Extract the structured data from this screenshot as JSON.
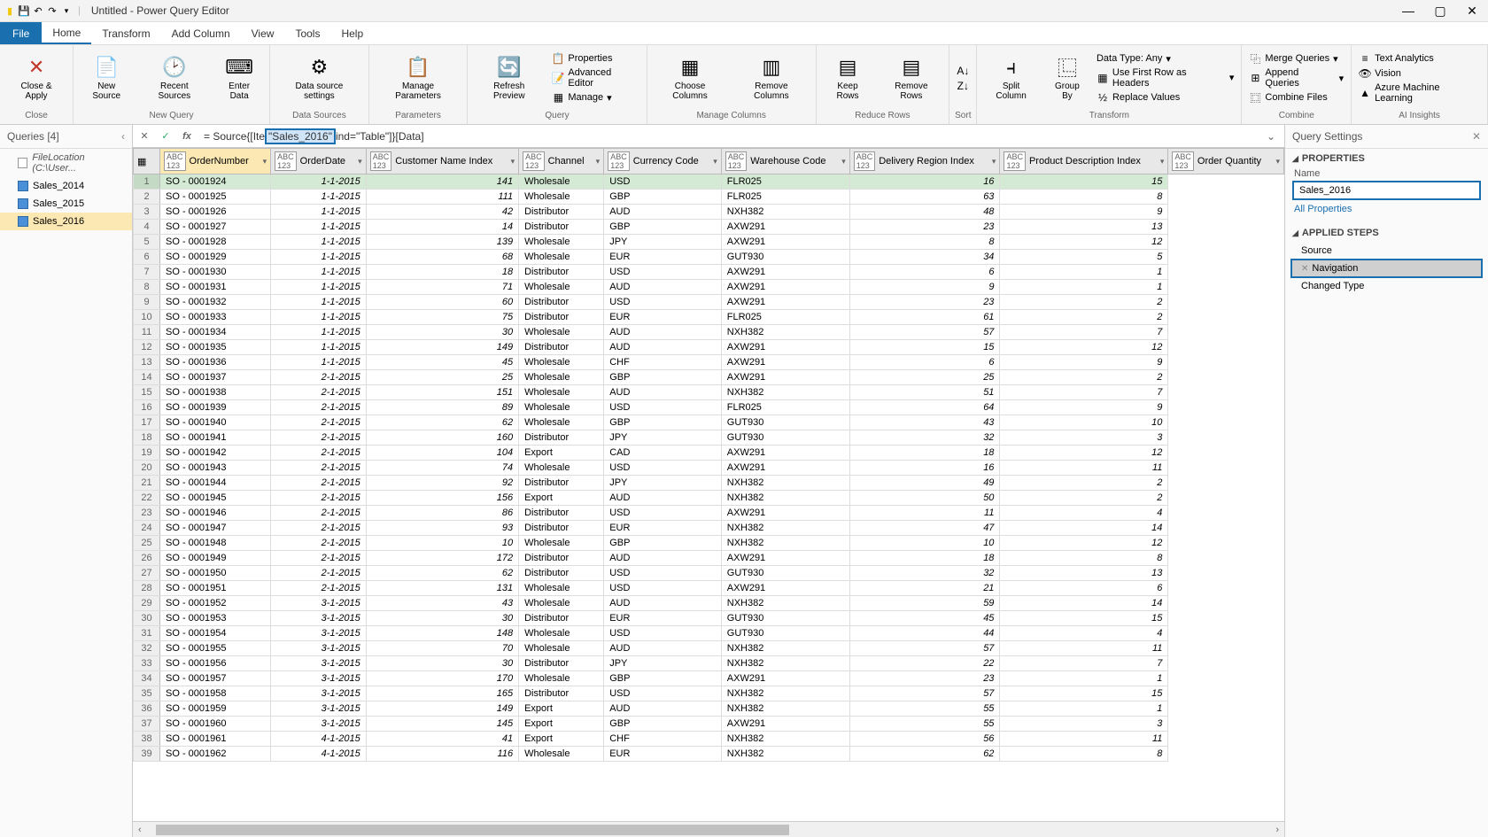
{
  "window": {
    "title": "Untitled - Power Query Editor"
  },
  "menu": {
    "file": "File",
    "tabs": [
      "Home",
      "Transform",
      "Add Column",
      "View",
      "Tools",
      "Help"
    ],
    "activeTab": 0
  },
  "ribbon": {
    "close": {
      "close_apply": "Close &\nApply",
      "group": "Close"
    },
    "newquery": {
      "new_source": "New\nSource",
      "recent_sources": "Recent\nSources",
      "enter_data": "Enter\nData",
      "group": "New Query"
    },
    "datasources": {
      "ds_settings": "Data source\nsettings",
      "group": "Data Sources"
    },
    "parameters": {
      "manage_params": "Manage\nParameters",
      "group": "Parameters"
    },
    "query": {
      "refresh": "Refresh\nPreview",
      "props": "Properties",
      "adv": "Advanced Editor",
      "manage": "Manage",
      "group": "Query"
    },
    "mcols": {
      "choose": "Choose\nColumns",
      "remove": "Remove\nColumns",
      "group": "Manage Columns"
    },
    "rrows": {
      "keep": "Keep\nRows",
      "remove": "Remove\nRows",
      "group": "Reduce Rows"
    },
    "sort": {
      "group": "Sort"
    },
    "transform": {
      "split": "Split\nColumn",
      "groupby": "Group\nBy",
      "dtype": "Data Type: Any",
      "firstrow": "Use First Row as Headers",
      "replace": "Replace Values",
      "group": "Transform"
    },
    "combine": {
      "merge": "Merge Queries",
      "append": "Append Queries",
      "files": "Combine Files",
      "group": "Combine"
    },
    "ai": {
      "text": "Text Analytics",
      "vision": "Vision",
      "ml": "Azure Machine Learning",
      "group": "AI Insights"
    }
  },
  "queries": {
    "header": "Queries [4]",
    "items": [
      {
        "label": "FileLocation (C:\\User...",
        "type": "loc"
      },
      {
        "label": "Sales_2014",
        "type": "q"
      },
      {
        "label": "Sales_2015",
        "type": "q"
      },
      {
        "label": "Sales_2016",
        "type": "q",
        "sel": true
      }
    ]
  },
  "formula": {
    "prefix": "= Source{[Ite",
    "highlight": "\"Sales_2016\"",
    "suffix": "ind=\"Table\"]}[Data]"
  },
  "columns": [
    "OrderNumber",
    "OrderDate",
    "Customer Name Index",
    "Channel",
    "Currency Code",
    "Warehouse Code",
    "Delivery Region Index",
    "Product Description Index",
    "Order Quantity"
  ],
  "rows": [
    {
      "n": 1,
      "on": "SO - 0001924",
      "od": "1-1-2015",
      "cn": 141,
      "ch": "Wholesale",
      "cc": "USD",
      "wc": "FLR025",
      "dr": 16,
      "pd": 15
    },
    {
      "n": 2,
      "on": "SO - 0001925",
      "od": "1-1-2015",
      "cn": 111,
      "ch": "Wholesale",
      "cc": "GBP",
      "wc": "FLR025",
      "dr": 63,
      "pd": 8
    },
    {
      "n": 3,
      "on": "SO - 0001926",
      "od": "1-1-2015",
      "cn": 42,
      "ch": "Distributor",
      "cc": "AUD",
      "wc": "NXH382",
      "dr": 48,
      "pd": 9
    },
    {
      "n": 4,
      "on": "SO - 0001927",
      "od": "1-1-2015",
      "cn": 14,
      "ch": "Distributor",
      "cc": "GBP",
      "wc": "AXW291",
      "dr": 23,
      "pd": 13
    },
    {
      "n": 5,
      "on": "SO - 0001928",
      "od": "1-1-2015",
      "cn": 139,
      "ch": "Wholesale",
      "cc": "JPY",
      "wc": "AXW291",
      "dr": 8,
      "pd": 12
    },
    {
      "n": 6,
      "on": "SO - 0001929",
      "od": "1-1-2015",
      "cn": 68,
      "ch": "Wholesale",
      "cc": "EUR",
      "wc": "GUT930",
      "dr": 34,
      "pd": 5
    },
    {
      "n": 7,
      "on": "SO - 0001930",
      "od": "1-1-2015",
      "cn": 18,
      "ch": "Distributor",
      "cc": "USD",
      "wc": "AXW291",
      "dr": 6,
      "pd": 1
    },
    {
      "n": 8,
      "on": "SO - 0001931",
      "od": "1-1-2015",
      "cn": 71,
      "ch": "Wholesale",
      "cc": "AUD",
      "wc": "AXW291",
      "dr": 9,
      "pd": 1
    },
    {
      "n": 9,
      "on": "SO - 0001932",
      "od": "1-1-2015",
      "cn": 60,
      "ch": "Distributor",
      "cc": "USD",
      "wc": "AXW291",
      "dr": 23,
      "pd": 2
    },
    {
      "n": 10,
      "on": "SO - 0001933",
      "od": "1-1-2015",
      "cn": 75,
      "ch": "Distributor",
      "cc": "EUR",
      "wc": "FLR025",
      "dr": 61,
      "pd": 2
    },
    {
      "n": 11,
      "on": "SO - 0001934",
      "od": "1-1-2015",
      "cn": 30,
      "ch": "Wholesale",
      "cc": "AUD",
      "wc": "NXH382",
      "dr": 57,
      "pd": 7
    },
    {
      "n": 12,
      "on": "SO - 0001935",
      "od": "1-1-2015",
      "cn": 149,
      "ch": "Distributor",
      "cc": "AUD",
      "wc": "AXW291",
      "dr": 15,
      "pd": 12
    },
    {
      "n": 13,
      "on": "SO - 0001936",
      "od": "1-1-2015",
      "cn": 45,
      "ch": "Wholesale",
      "cc": "CHF",
      "wc": "AXW291",
      "dr": 6,
      "pd": 9
    },
    {
      "n": 14,
      "on": "SO - 0001937",
      "od": "2-1-2015",
      "cn": 25,
      "ch": "Wholesale",
      "cc": "GBP",
      "wc": "AXW291",
      "dr": 25,
      "pd": 2
    },
    {
      "n": 15,
      "on": "SO - 0001938",
      "od": "2-1-2015",
      "cn": 151,
      "ch": "Wholesale",
      "cc": "AUD",
      "wc": "NXH382",
      "dr": 51,
      "pd": 7
    },
    {
      "n": 16,
      "on": "SO - 0001939",
      "od": "2-1-2015",
      "cn": 89,
      "ch": "Wholesale",
      "cc": "USD",
      "wc": "FLR025",
      "dr": 64,
      "pd": 9
    },
    {
      "n": 17,
      "on": "SO - 0001940",
      "od": "2-1-2015",
      "cn": 62,
      "ch": "Wholesale",
      "cc": "GBP",
      "wc": "GUT930",
      "dr": 43,
      "pd": 10
    },
    {
      "n": 18,
      "on": "SO - 0001941",
      "od": "2-1-2015",
      "cn": 160,
      "ch": "Distributor",
      "cc": "JPY",
      "wc": "GUT930",
      "dr": 32,
      "pd": 3
    },
    {
      "n": 19,
      "on": "SO - 0001942",
      "od": "2-1-2015",
      "cn": 104,
      "ch": "Export",
      "cc": "CAD",
      "wc": "AXW291",
      "dr": 18,
      "pd": 12
    },
    {
      "n": 20,
      "on": "SO - 0001943",
      "od": "2-1-2015",
      "cn": 74,
      "ch": "Wholesale",
      "cc": "USD",
      "wc": "AXW291",
      "dr": 16,
      "pd": 11
    },
    {
      "n": 21,
      "on": "SO - 0001944",
      "od": "2-1-2015",
      "cn": 92,
      "ch": "Distributor",
      "cc": "JPY",
      "wc": "NXH382",
      "dr": 49,
      "pd": 2
    },
    {
      "n": 22,
      "on": "SO - 0001945",
      "od": "2-1-2015",
      "cn": 156,
      "ch": "Export",
      "cc": "AUD",
      "wc": "NXH382",
      "dr": 50,
      "pd": 2
    },
    {
      "n": 23,
      "on": "SO - 0001946",
      "od": "2-1-2015",
      "cn": 86,
      "ch": "Distributor",
      "cc": "USD",
      "wc": "AXW291",
      "dr": 11,
      "pd": 4
    },
    {
      "n": 24,
      "on": "SO - 0001947",
      "od": "2-1-2015",
      "cn": 93,
      "ch": "Distributor",
      "cc": "EUR",
      "wc": "NXH382",
      "dr": 47,
      "pd": 14
    },
    {
      "n": 25,
      "on": "SO - 0001948",
      "od": "2-1-2015",
      "cn": 10,
      "ch": "Wholesale",
      "cc": "GBP",
      "wc": "NXH382",
      "dr": 10,
      "pd": 12
    },
    {
      "n": 26,
      "on": "SO - 0001949",
      "od": "2-1-2015",
      "cn": 172,
      "ch": "Distributor",
      "cc": "AUD",
      "wc": "AXW291",
      "dr": 18,
      "pd": 8
    },
    {
      "n": 27,
      "on": "SO - 0001950",
      "od": "2-1-2015",
      "cn": 62,
      "ch": "Distributor",
      "cc": "USD",
      "wc": "GUT930",
      "dr": 32,
      "pd": 13
    },
    {
      "n": 28,
      "on": "SO - 0001951",
      "od": "2-1-2015",
      "cn": 131,
      "ch": "Wholesale",
      "cc": "USD",
      "wc": "AXW291",
      "dr": 21,
      "pd": 6
    },
    {
      "n": 29,
      "on": "SO - 0001952",
      "od": "3-1-2015",
      "cn": 43,
      "ch": "Wholesale",
      "cc": "AUD",
      "wc": "NXH382",
      "dr": 59,
      "pd": 14
    },
    {
      "n": 30,
      "on": "SO - 0001953",
      "od": "3-1-2015",
      "cn": 30,
      "ch": "Distributor",
      "cc": "EUR",
      "wc": "GUT930",
      "dr": 45,
      "pd": 15
    },
    {
      "n": 31,
      "on": "SO - 0001954",
      "od": "3-1-2015",
      "cn": 148,
      "ch": "Wholesale",
      "cc": "USD",
      "wc": "GUT930",
      "dr": 44,
      "pd": 4
    },
    {
      "n": 32,
      "on": "SO - 0001955",
      "od": "3-1-2015",
      "cn": 70,
      "ch": "Wholesale",
      "cc": "AUD",
      "wc": "NXH382",
      "dr": 57,
      "pd": 11
    },
    {
      "n": 33,
      "on": "SO - 0001956",
      "od": "3-1-2015",
      "cn": 30,
      "ch": "Distributor",
      "cc": "JPY",
      "wc": "NXH382",
      "dr": 22,
      "pd": 7
    },
    {
      "n": 34,
      "on": "SO - 0001957",
      "od": "3-1-2015",
      "cn": 170,
      "ch": "Wholesale",
      "cc": "GBP",
      "wc": "AXW291",
      "dr": 23,
      "pd": 1
    },
    {
      "n": 35,
      "on": "SO - 0001958",
      "od": "3-1-2015",
      "cn": 165,
      "ch": "Distributor",
      "cc": "USD",
      "wc": "NXH382",
      "dr": 57,
      "pd": 15
    },
    {
      "n": 36,
      "on": "SO - 0001959",
      "od": "3-1-2015",
      "cn": 149,
      "ch": "Export",
      "cc": "AUD",
      "wc": "NXH382",
      "dr": 55,
      "pd": 1
    },
    {
      "n": 37,
      "on": "SO - 0001960",
      "od": "3-1-2015",
      "cn": 145,
      "ch": "Export",
      "cc": "GBP",
      "wc": "AXW291",
      "dr": 55,
      "pd": 3
    },
    {
      "n": 38,
      "on": "SO - 0001961",
      "od": "4-1-2015",
      "cn": 41,
      "ch": "Export",
      "cc": "CHF",
      "wc": "NXH382",
      "dr": 56,
      "pd": 11
    },
    {
      "n": 39,
      "on": "SO - 0001962",
      "od": "4-1-2015",
      "cn": 116,
      "ch": "Wholesale",
      "cc": "EUR",
      "wc": "NXH382",
      "dr": 62,
      "pd": 8
    }
  ],
  "settings": {
    "header": "Query Settings",
    "properties": "PROPERTIES",
    "nameLabel": "Name",
    "nameValue": "Sales_2016",
    "allProps": "All Properties",
    "applied": "APPLIED STEPS",
    "steps": [
      {
        "label": "Source",
        "sel": false
      },
      {
        "label": "Navigation",
        "sel": true
      },
      {
        "label": "Changed Type",
        "sel": false
      }
    ]
  }
}
